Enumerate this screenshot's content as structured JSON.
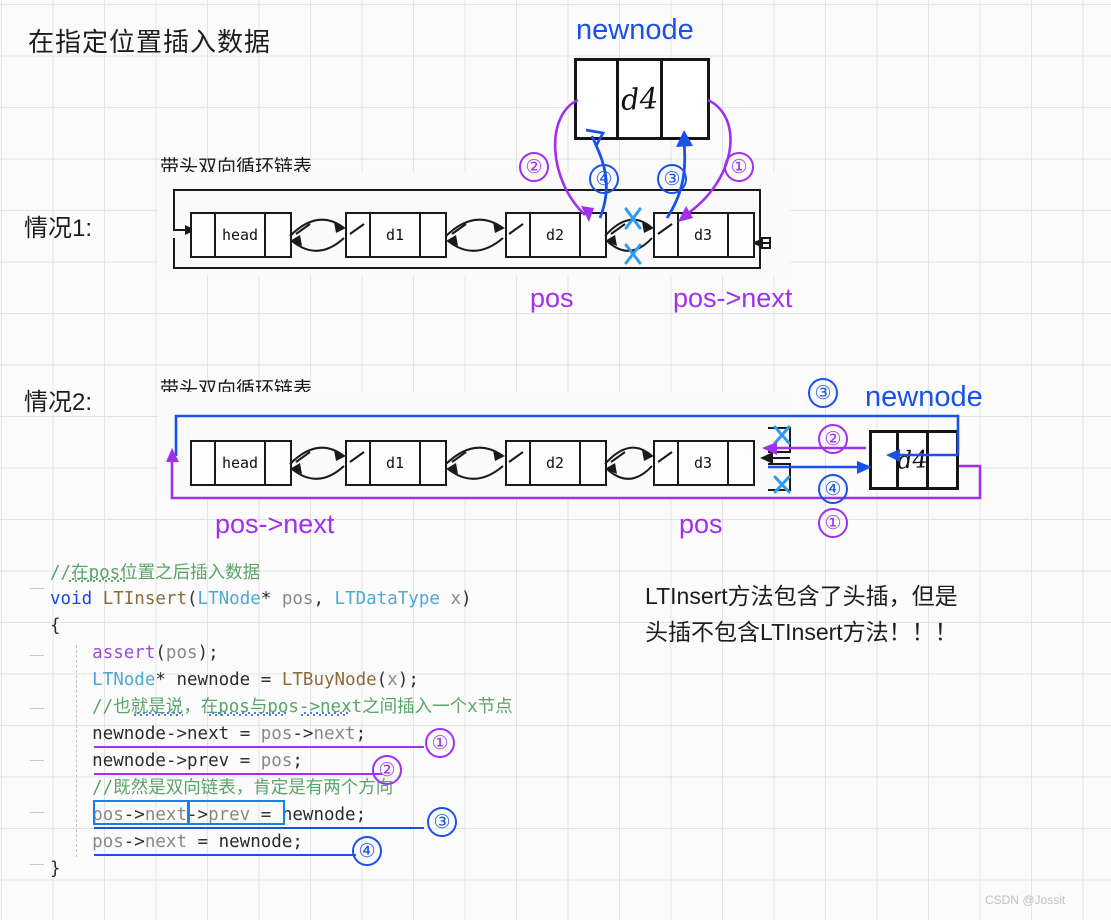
{
  "page": {
    "title": "在指定位置插入数据",
    "watermark": "CSDN @Jossit"
  },
  "colors": {
    "blue": "#1a52e8",
    "purple": "#a12ff0",
    "cyan_x": "#2e9bf0",
    "ink": "#1a1a1a",
    "comment_green": "#5aa469"
  },
  "case1": {
    "label": "情况1:",
    "list_caption": "带头双向循环链表",
    "nodes": [
      "head",
      "d1",
      "d2",
      "d3"
    ],
    "pos_label": "pos",
    "pos_next_label": "pos->next",
    "newnode_label": "newnode",
    "newnode_value": "d4",
    "step_markers": [
      {
        "n": "①",
        "color": "purple"
      },
      {
        "n": "②",
        "color": "purple"
      },
      {
        "n": "③",
        "color": "blue"
      },
      {
        "n": "④",
        "color": "blue"
      }
    ]
  },
  "case2": {
    "label": "情况2:",
    "list_caption": "带头双向循环链表",
    "nodes": [
      "head",
      "d1",
      "d2",
      "d3"
    ],
    "pos_label": "pos",
    "pos_next_label": "pos->next",
    "newnode_label": "newnode",
    "newnode_value": "d4",
    "step_markers": [
      {
        "n": "①",
        "color": "purple"
      },
      {
        "n": "②",
        "color": "purple"
      },
      {
        "n": "③",
        "color": "blue"
      },
      {
        "n": "④",
        "color": "blue"
      }
    ]
  },
  "code": {
    "lines": [
      "//在pos位置之后插入数据",
      "void LTInsert(LTNode* pos, LTDataType x)",
      "{",
      "    assert(pos);",
      "    LTNode* newnode = LTBuyNode(x);",
      "    //也就是说，在pos与pos->next之间插入一个x节点",
      "    newnode->next = pos->next;",
      "    newnode->prev = pos;",
      "    //既然是双向链表，肯定是有两个方向",
      "    pos->next->prev = newnode;",
      "    pos->next = newnode;",
      "}"
    ],
    "annotations": [
      {
        "n": "①",
        "color": "purple",
        "for": "newnode->next = pos->next;"
      },
      {
        "n": "②",
        "color": "purple",
        "for": "newnode->prev = pos;"
      },
      {
        "n": "③",
        "color": "blue",
        "for": "pos->next->prev = newnode;"
      },
      {
        "n": "④",
        "color": "blue",
        "for": "pos->next = newnode;"
      }
    ],
    "highlight_box": "pos->next->prev"
  },
  "note": {
    "line1": "LTInsert方法包含了头插，但是",
    "line2": "头插不包含LTInsert方法！！！"
  }
}
